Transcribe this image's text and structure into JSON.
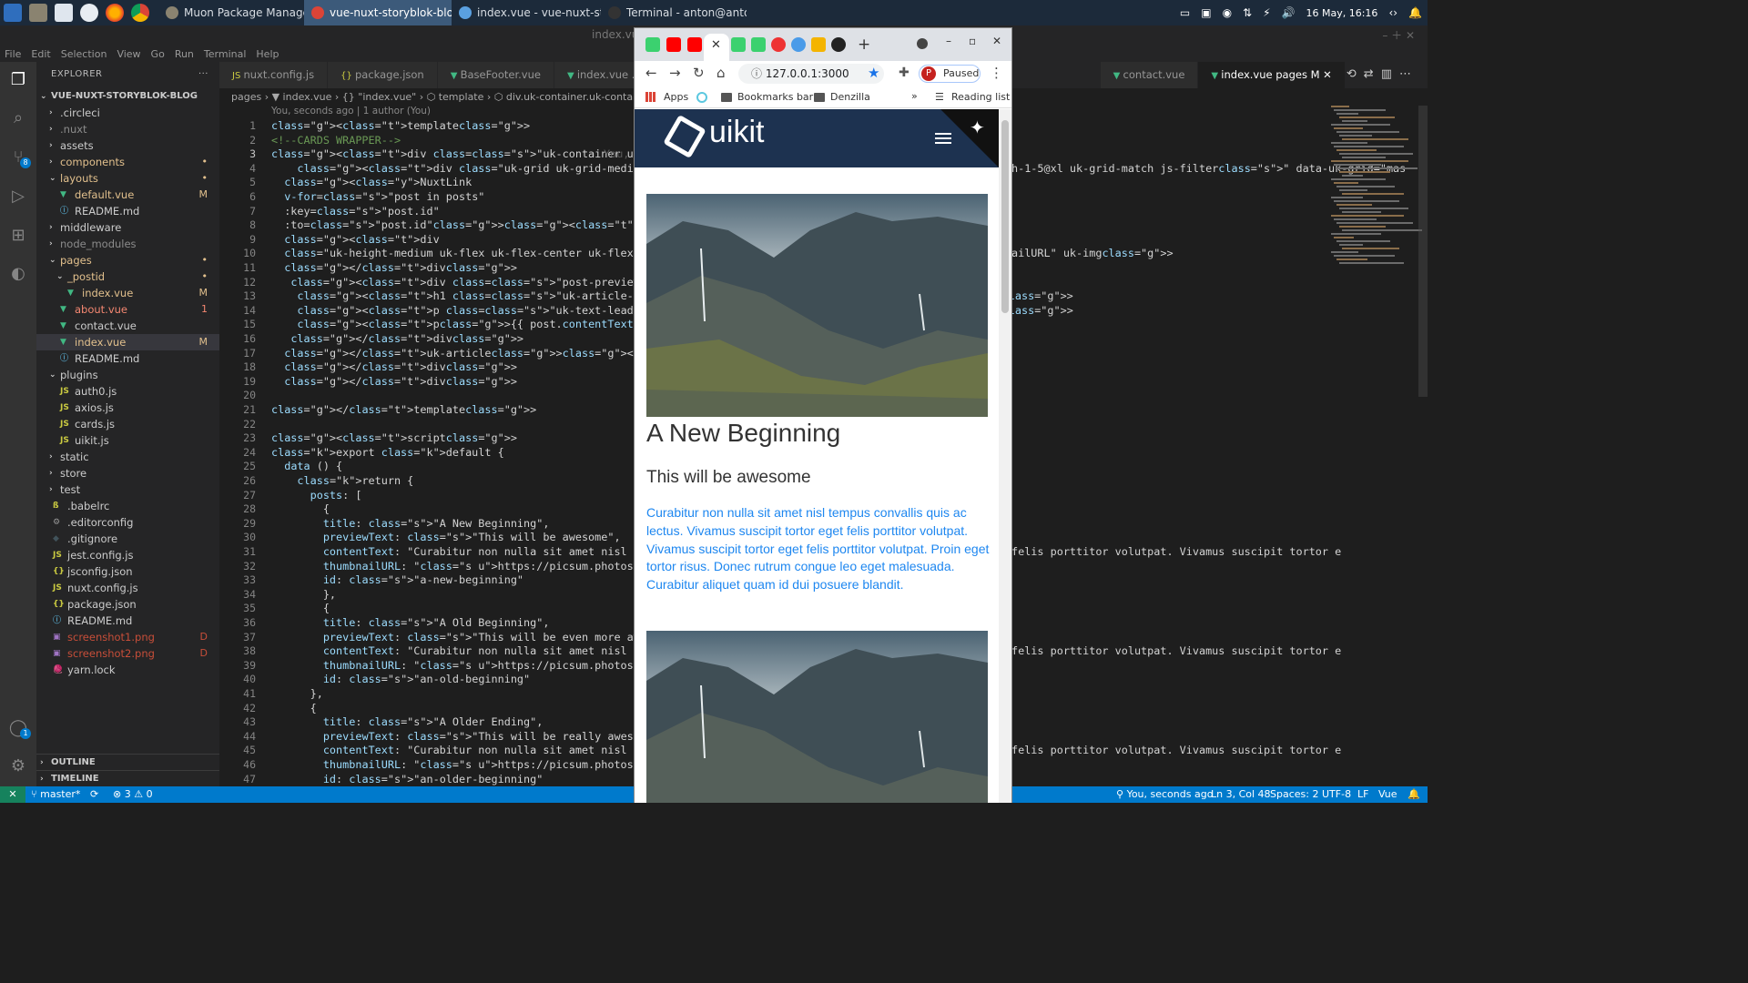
{
  "taskbar": {
    "tasks": [
      {
        "label": "Muon Package Manager",
        "active": false
      },
      {
        "label": "vue-nuxt-storyblok-blog - Go...",
        "active": true
      },
      {
        "label": "index.vue - vue-nuxt-storybl...",
        "active": false
      },
      {
        "label": "Terminal - anton@anton-Thi...",
        "active": false
      }
    ],
    "clock": "16 May, 16:16"
  },
  "vscode": {
    "window_title": "index.vue",
    "menu": [
      "File",
      "Edit",
      "Selection",
      "View",
      "Go",
      "Run",
      "Terminal",
      "Help"
    ],
    "explorer_title": "EXPLORER",
    "explorer_more": "···",
    "project_name": "VUE-NUXT-STORYBLOK-BLOG",
    "files": [
      {
        "name": ".circleci",
        "type": "folder",
        "indent": 1,
        "color": "#cccccc",
        "badge": ""
      },
      {
        "name": ".nuxt",
        "type": "folder",
        "indent": 1,
        "color": "#8b8b8b",
        "badge": ""
      },
      {
        "name": "assets",
        "type": "folder",
        "indent": 1,
        "color": "#cccccc",
        "badge": ""
      },
      {
        "name": "components",
        "type": "folder",
        "indent": 1,
        "color": "#e2c08d",
        "badge": "•"
      },
      {
        "name": "layouts",
        "type": "folder-open",
        "indent": 1,
        "color": "#e2c08d",
        "badge": "•"
      },
      {
        "name": "default.vue",
        "type": "vue",
        "indent": 2,
        "color": "#e2c08d",
        "badge": "M"
      },
      {
        "name": "README.md",
        "type": "info",
        "indent": 2,
        "color": "#cccccc",
        "badge": ""
      },
      {
        "name": "middleware",
        "type": "folder",
        "indent": 1,
        "color": "#cccccc",
        "badge": ""
      },
      {
        "name": "node_modules",
        "type": "folder",
        "indent": 1,
        "color": "#8b8b8b",
        "badge": ""
      },
      {
        "name": "pages",
        "type": "folder-open",
        "indent": 1,
        "color": "#e2c08d",
        "badge": "•"
      },
      {
        "name": "_postid",
        "type": "folder-open",
        "indent": 2,
        "color": "#e2c08d",
        "badge": "•"
      },
      {
        "name": "index.vue",
        "type": "vue",
        "indent": 3,
        "color": "#e2c08d",
        "badge": "M"
      },
      {
        "name": "about.vue",
        "type": "vue",
        "indent": 2,
        "color": "#f48771",
        "badge": "1"
      },
      {
        "name": "contact.vue",
        "type": "vue",
        "indent": 2,
        "color": "#cccccc",
        "badge": ""
      },
      {
        "name": "index.vue",
        "type": "vue",
        "indent": 2,
        "color": "#e2c08d",
        "badge": "M",
        "selected": true
      },
      {
        "name": "README.md",
        "type": "info",
        "indent": 2,
        "color": "#cccccc",
        "badge": ""
      },
      {
        "name": "plugins",
        "type": "folder-open",
        "indent": 1,
        "color": "#cccccc",
        "badge": ""
      },
      {
        "name": "auth0.js",
        "type": "js",
        "indent": 2,
        "color": "#cccccc",
        "badge": ""
      },
      {
        "name": "axios.js",
        "type": "js",
        "indent": 2,
        "color": "#cccccc",
        "badge": ""
      },
      {
        "name": "cards.js",
        "type": "js",
        "indent": 2,
        "color": "#cccccc",
        "badge": ""
      },
      {
        "name": "uikit.js",
        "type": "js",
        "indent": 2,
        "color": "#cccccc",
        "badge": ""
      },
      {
        "name": "static",
        "type": "folder",
        "indent": 1,
        "color": "#cccccc",
        "badge": ""
      },
      {
        "name": "store",
        "type": "folder",
        "indent": 1,
        "color": "#cccccc",
        "badge": ""
      },
      {
        "name": "test",
        "type": "folder",
        "indent": 1,
        "color": "#cccccc",
        "badge": ""
      },
      {
        "name": ".babelrc",
        "type": "babel",
        "indent": 1,
        "color": "#cccccc",
        "badge": ""
      },
      {
        "name": ".editorconfig",
        "type": "gear",
        "indent": 1,
        "color": "#cccccc",
        "badge": ""
      },
      {
        "name": ".gitignore",
        "type": "git",
        "indent": 1,
        "color": "#cccccc",
        "badge": ""
      },
      {
        "name": "jest.config.js",
        "type": "js",
        "indent": 1,
        "color": "#cccccc",
        "badge": ""
      },
      {
        "name": "jsconfig.json",
        "type": "json",
        "indent": 1,
        "color": "#cccccc",
        "badge": ""
      },
      {
        "name": "nuxt.config.js",
        "type": "js",
        "indent": 1,
        "color": "#cccccc",
        "badge": ""
      },
      {
        "name": "package.json",
        "type": "json",
        "indent": 1,
        "color": "#cccccc",
        "badge": ""
      },
      {
        "name": "README.md",
        "type": "info",
        "indent": 1,
        "color": "#cccccc",
        "badge": ""
      },
      {
        "name": "screenshot1.png",
        "type": "img",
        "indent": 1,
        "color": "#c74e39",
        "badge": "D"
      },
      {
        "name": "screenshot2.png",
        "type": "img",
        "indent": 1,
        "color": "#c74e39",
        "badge": "D"
      },
      {
        "name": "yarn.lock",
        "type": "yarn",
        "indent": 1,
        "color": "#cccccc",
        "badge": ""
      }
    ],
    "outline_label": "OUTLINE",
    "timeline_label": "TIMELINE",
    "tabs": [
      {
        "label": "nuxt.config.js",
        "icon": "JS"
      },
      {
        "label": "package.json",
        "icon": "{}"
      },
      {
        "label": "BaseFooter.vue",
        "icon": "V"
      },
      {
        "label": "index.vue .../_p",
        "icon": "V"
      },
      {
        "label": "contact.vue",
        "icon": "V"
      },
      {
        "label": "index.vue pages M",
        "icon": "V",
        "active": true
      }
    ],
    "breadcrumb": "pages › ▼ index.vue › {} \"index.vue\" › ⬡ template › ⬡ div.uk-container.uk-container",
    "blame": "You, seconds ago | 1 author (You)",
    "inline_blame": "You,",
    "code_left": [
      "<template>",
      "<!--CARDS WRAPPER-->",
      "<div class=\"uk-container uk-container-expand\">",
      "    <div class=\"uk-grid uk-grid-medium uk-child-width-1-",
      "  <NuxtLink",
      "  v-for=\"post in posts\"",
      "  :key=\"post.id\"",
      "  :to=\"post.id\"><uk-article class=\"uk-article\">",
      "  <div",
      "  class=\"uk-height-medium uk-flex uk-flex-center uk-flex",
      "  </div>",
      "   <div class=\"post-preview-content\">",
      "    <h1 class=\"uk-article-title\">{{ post.title }}</h1>",
      "    <p class=\"uk-text-lead\">{{ post.previewText }}</p>",
      "    <p>{{ post.contentText }}</p>",
      "   </div>",
      "  </uk-article></NuxtLink>",
      "  </div>",
      "  </div>",
      "",
      "</template>",
      "",
      "<script>",
      "export default {",
      "  data () {",
      "    return {",
      "      posts: [",
      "        {",
      "        title: \"A New Beginning\",",
      "        previewText: \"This will be awesome\",",
      "        contentText: \"Curabitur non nulla sit amet nisl te",
      "        thumbnailURL: \"https://picsum.photos/400/300\",",
      "        id: \"a-new-beginning\"",
      "        },",
      "        {",
      "        title: \"A Old Beginning\",",
      "        previewText: \"This will be even more awesome\",",
      "        contentText: \"Curabitur non nulla sit amet nisl te",
      "        thumbnailURL: \"https://picsum.photos/400/300\",",
      "        id: \"an-old-beginning\"",
      "      },",
      "      {",
      "        title: \"A Older Ending\",",
      "        previewText: \"This will be really awesome\",",
      "        contentText: \"Curabitur non nulla sit amet nisl te",
      "        thumbnailURL: \"https://picsum.photos/400/300\",",
      "        id: \"an-older-beginning\""
    ],
    "code_right": {
      "line4": "h-1-5@xl uk-grid-match js-filter\" data-uk-grid=\"mas",
      "line10": "ailURL\" uk-img>",
      "line31": "felis porttitor volutpat. Vivamus suscipit tortor e",
      "line38": "felis porttitor volutpat. Vivamus suscipit tortor e",
      "line45": "felis porttitor volutpat. Vivamus suscipit tortor e"
    },
    "status": {
      "branch": "master*",
      "sync": "⟳",
      "problems": "⊗ 3 ⚠ 0",
      "blame": "You, seconds ago",
      "position": "Ln 3, Col 48",
      "spaces": "Spaces: 2",
      "encoding": "UTF-8",
      "eol": "LF",
      "language": "Vue"
    }
  },
  "chrome": {
    "url": "127.0.0.1:3000",
    "profile_initial": "P",
    "profile_status": "Paused",
    "bookmarks": [
      "Apps",
      "Bookmarks bar",
      "Denzilla"
    ],
    "reading_list": "Reading list",
    "site": {
      "logo": "uikit",
      "posts": [
        {
          "title": "A New Beginning",
          "preview": "This will be awesome",
          "content": "Curabitur non nulla sit amet nisl tempus convallis quis ac lectus. Vivamus suscipit tortor eget felis porttitor volutpat. Vivamus suscipit tortor eget felis porttitor volutpat. Proin eget tortor risus. Donec rutrum congue leo eget malesuada. Curabitur aliquet quam id dui posuere blandit."
        }
      ]
    }
  },
  "colors": {
    "vscode_bg": "#1e1e1e",
    "statusbar": "#007acc",
    "uikit_nav": "#1d3250",
    "link_blue": "#1e87f0"
  }
}
